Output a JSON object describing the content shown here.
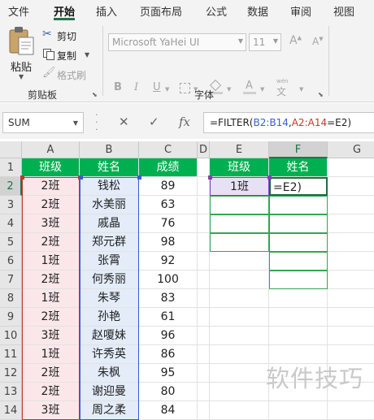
{
  "menu": {
    "tabs": [
      {
        "label": "文件",
        "active": false
      },
      {
        "label": "开始",
        "active": true
      },
      {
        "label": "插入",
        "active": false
      },
      {
        "label": "页面布局",
        "active": false
      },
      {
        "label": "公式",
        "active": false
      },
      {
        "label": "数据",
        "active": false
      },
      {
        "label": "审阅",
        "active": false
      },
      {
        "label": "视图",
        "active": false
      }
    ]
  },
  "ribbon": {
    "clipboard": {
      "paste_label": "粘贴",
      "cut_label": "剪切",
      "copy_label": "复制",
      "format_painter_label": "格式刷",
      "group_label": "剪贴板"
    },
    "font": {
      "font_name": "Microsoft YaHei UI",
      "font_size": "11",
      "group_label": "字体",
      "phonetic_glyph": "wén"
    }
  },
  "formula_bar": {
    "name_box": "SUM",
    "formula_parts": [
      "=FILTER(",
      "B2:B14",
      ",",
      "A2:A14",
      "=E2)"
    ]
  },
  "columns": [
    "A",
    "B",
    "C",
    "D",
    "E",
    "F",
    "G"
  ],
  "rows": [
    "1",
    "2",
    "3",
    "4",
    "5",
    "6",
    "7",
    "8",
    "9",
    "10",
    "11",
    "12",
    "13",
    "14"
  ],
  "table": {
    "headers": [
      "班级",
      "姓名",
      "成绩"
    ],
    "records": [
      [
        "2班",
        "钱松",
        "89"
      ],
      [
        "2班",
        "水美丽",
        "63"
      ],
      [
        "3班",
        "戚晶",
        "76"
      ],
      [
        "2班",
        "郑元群",
        "98"
      ],
      [
        "1班",
        "张霄",
        "92"
      ],
      [
        "2班",
        "何秀丽",
        "100"
      ],
      [
        "1班",
        "朱琴",
        "83"
      ],
      [
        "2班",
        "孙艳",
        "61"
      ],
      [
        "3班",
        "赵嗄妹",
        "96"
      ],
      [
        "1班",
        "许秀英",
        "86"
      ],
      [
        "2班",
        "朱枫",
        "95"
      ],
      [
        "2班",
        "谢迎曼",
        "80"
      ],
      [
        "3班",
        "周之柔",
        "84"
      ]
    ]
  },
  "lookup": {
    "headers": [
      "班级",
      "姓名"
    ],
    "criteria": "1班",
    "editing_text": "=E2)"
  },
  "watermark": "软件技巧",
  "colors": {
    "header_fill": "#00b050",
    "accent": "#217346",
    "range_red": "#c0392b",
    "range_blue": "#3b5bd6"
  }
}
